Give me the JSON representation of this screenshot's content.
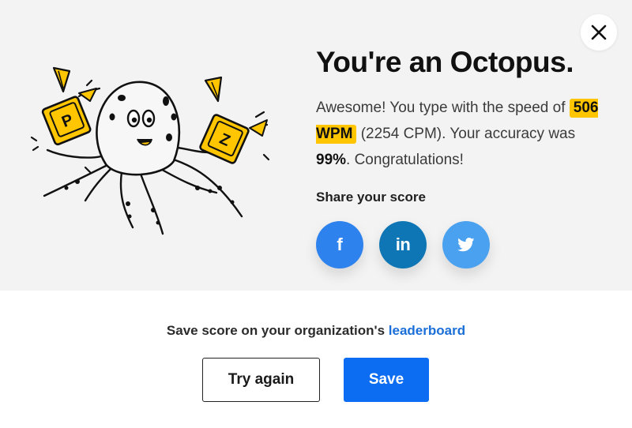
{
  "modal": {
    "title": "You're an Octopus.",
    "description": {
      "part1": "Awesome! You type with the speed of ",
      "wpm": "506 WPM",
      "part2": " (2254 CPM). Your accuracy was ",
      "accuracy": "99%",
      "part3": ". Congratulations!"
    },
    "illustration": {
      "name": "octopus-juggling-keys-illustration",
      "key_letters": [
        "P",
        "Z"
      ]
    },
    "share": {
      "label": "Share your score",
      "buttons": [
        {
          "name": "facebook",
          "glyph": "f",
          "color": "#2e82ed"
        },
        {
          "name": "linkedin",
          "glyph": "in",
          "color": "#0f76b5"
        },
        {
          "name": "twitter",
          "glyph": "twitter-bird-icon",
          "color": "#4aa1ef"
        }
      ]
    },
    "leaderboard": {
      "text": "Save score on your organization's ",
      "link": "leaderboard"
    },
    "actions": {
      "try_again": "Try again",
      "save": "Save"
    },
    "colors": {
      "highlight": "#ffc600",
      "primary": "#0c6cf2",
      "link": "#1b6fd8",
      "top_background": "#f3f3f3"
    }
  }
}
